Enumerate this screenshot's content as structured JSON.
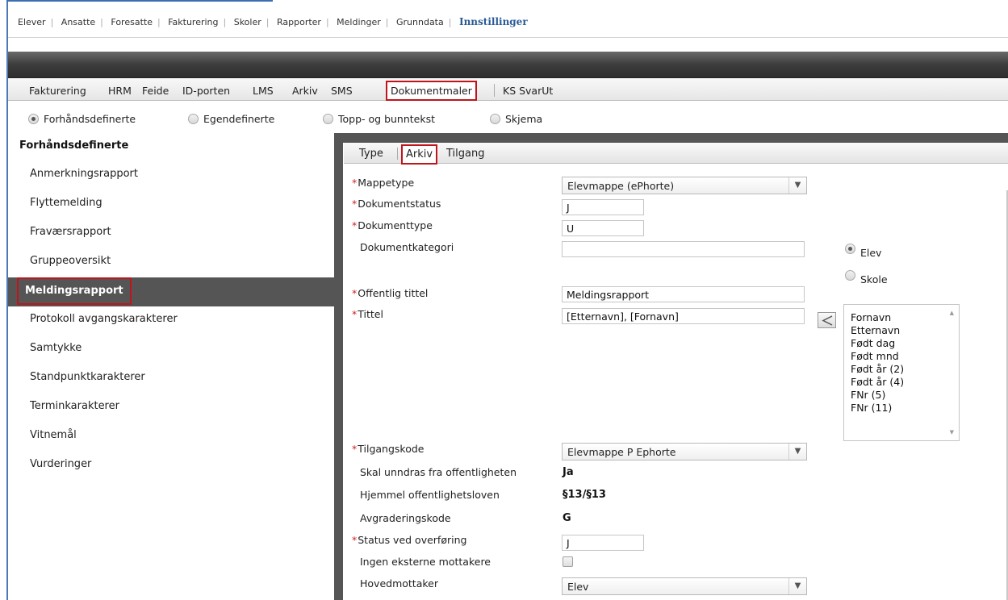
{
  "top_nav": {
    "items": [
      "Elever",
      "Ansatte",
      "Foresatte",
      "Fakturering",
      "Skoler",
      "Rapporter",
      "Meldinger",
      "Grunndata"
    ],
    "active": "Innstillinger"
  },
  "settings_tabs": {
    "items": [
      "Fakturering",
      "HRM",
      "Feide",
      "ID-porten",
      "LMS",
      "Arkiv",
      "SMS"
    ],
    "selected": "Dokumentmaler",
    "after": "KS SvarUt"
  },
  "template_types": {
    "options": [
      "Forhåndsdefinerte",
      "Egendefinerte",
      "Topp- og bunntekst",
      "Skjema"
    ],
    "selected_index": 0
  },
  "sidebar": {
    "title": "Forhåndsdefinerte",
    "items": [
      "Anmerkningsrapport",
      "Flyttemelding",
      "Fraværsrapport",
      "Gruppeoversikt",
      "Meldingsrapport",
      "Protokoll avgangskarakterer",
      "Samtykke",
      "Standpunktkarakterer",
      "Terminkarakterer",
      "Vitnemål",
      "Vurderinger"
    ],
    "selected_index": 4
  },
  "detail_tabs": {
    "items": [
      "Type",
      "Arkiv",
      "Tilgang"
    ],
    "selected_index": 1
  },
  "form": {
    "mappetype": {
      "label": "Mappetype",
      "value": "Elevmappe (ePhorte)"
    },
    "dokumentstatus": {
      "label": "Dokumentstatus",
      "value": "J"
    },
    "dokumenttype": {
      "label": "Dokumenttype",
      "value": "U"
    },
    "dokumentkategori": {
      "label": "Dokumentkategori",
      "value": ""
    },
    "offentlig_tittel": {
      "label": "Offentlig tittel",
      "value": "Meldingsrapport"
    },
    "tittel": {
      "label": "Tittel",
      "value": "[Etternavn], [Fornavn]"
    },
    "tilgangskode": {
      "label": "Tilgangskode",
      "value": "Elevmappe P Ephorte"
    },
    "skal_unndras": {
      "label": "Skal unndras fra offentligheten",
      "value": "Ja"
    },
    "hjemmel": {
      "label": "Hjemmel offentlighetsloven",
      "value": "§13/§13"
    },
    "avgraderingskode": {
      "label": "Avgraderingskode",
      "value": "G"
    },
    "status_overforing": {
      "label": "Status ved overføring",
      "value": "J"
    },
    "ingen_eksterne": {
      "label": "Ingen eksterne mottakere",
      "checked": false
    },
    "hovedmottaker": {
      "label": "Hovedmottaker",
      "value": "Elev"
    },
    "required_mark": "*"
  },
  "recipient_scope": {
    "options": [
      "Elev",
      "Skole"
    ],
    "selected_index": 0
  },
  "merge_fields": [
    "Fornavn",
    "Etternavn",
    "Født dag",
    "Født mnd",
    "Født år (2)",
    "Født år (4)",
    "FNr (5)",
    "FNr (11)"
  ],
  "icons": {
    "insert_field": "arrow-left-icon",
    "dropdown": "chevron-down-icon"
  },
  "colors": {
    "accent_blue": "#2a5b97",
    "highlight_red": "#c0141b",
    "required_red": "#d0201e",
    "selected_bg": "#555555"
  }
}
